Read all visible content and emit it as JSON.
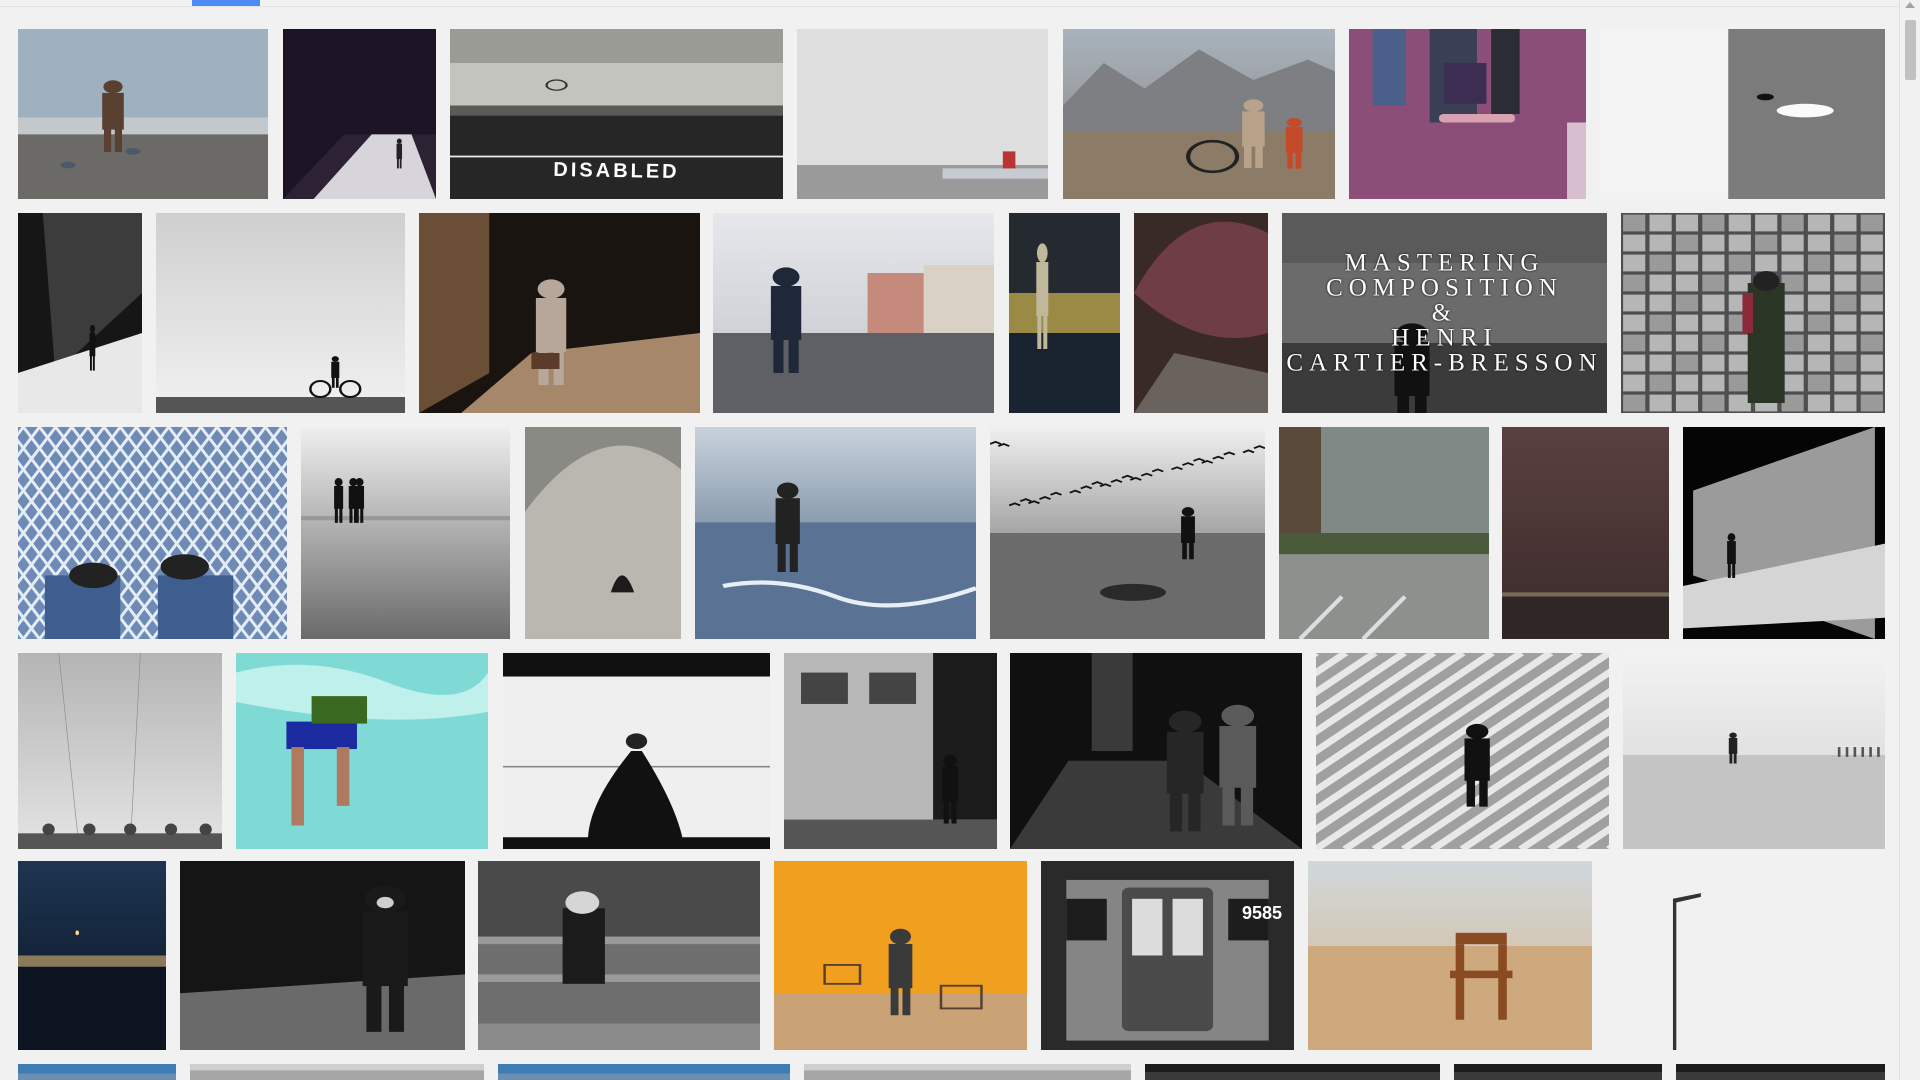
{
  "page": {
    "active_tab_color": "#4c8bf5",
    "rows": [
      {
        "images": [
          {
            "kind": "man-on-bench",
            "name": "image-man-bench-pigeons"
          },
          {
            "kind": "tunnel",
            "name": "image-dark-tunnel"
          },
          {
            "kind": "disabled-road",
            "name": "image-disabled-road",
            "text": "DISABLED"
          },
          {
            "kind": "white-wall-hydrant",
            "name": "image-white-wall-hydrant"
          },
          {
            "kind": "mountain-hoop",
            "name": "image-mountain-hoop-boys"
          },
          {
            "kind": "skateboard",
            "name": "image-purple-skateboard"
          },
          {
            "kind": "water-split",
            "name": "image-swans-water-split"
          }
        ]
      },
      {
        "images": [
          {
            "kind": "stairs-shadow",
            "name": "image-stairs-shadow"
          },
          {
            "kind": "bicycle",
            "name": "image-cyclist-horizon"
          },
          {
            "kind": "man-suitcase",
            "name": "image-man-suitcase"
          },
          {
            "kind": "city-walker",
            "name": "image-city-walker"
          },
          {
            "kind": "narrow-walker",
            "name": "image-narrow-walker"
          },
          {
            "kind": "umbrella",
            "name": "image-red-umbrella"
          },
          {
            "kind": "title-card",
            "name": "image-mastering-composition",
            "text": "MASTERING\nCOMPOSITION\n&\nHENRI\nCARTIER-BRESSON"
          },
          {
            "kind": "glass-grid",
            "name": "image-glass-block-wall"
          }
        ]
      },
      {
        "images": [
          {
            "kind": "mesh-feet",
            "name": "image-mesh-feet"
          },
          {
            "kind": "reflection",
            "name": "image-people-reflection"
          },
          {
            "kind": "cave-arch",
            "name": "image-cave-arch"
          },
          {
            "kind": "sea-chair",
            "name": "image-sea-chair"
          },
          {
            "kind": "birds-beach",
            "name": "image-birds-beach"
          },
          {
            "kind": "rainy-window",
            "name": "image-rainy-window"
          },
          {
            "kind": "dusk-field",
            "name": "image-dusk-field"
          },
          {
            "kind": "light-beam",
            "name": "image-light-beam"
          }
        ]
      },
      {
        "images": [
          {
            "kind": "power-lines",
            "name": "image-power-lines-trees"
          },
          {
            "kind": "swimmer",
            "name": "image-swimmer-pool"
          },
          {
            "kind": "cloaked-figure",
            "name": "image-cloaked-figure"
          },
          {
            "kind": "brick-building",
            "name": "image-brick-building-walker"
          },
          {
            "kind": "night-street",
            "name": "image-night-street"
          },
          {
            "kind": "diagonal-stripes",
            "name": "image-diagonal-stripes-walker"
          },
          {
            "kind": "foggy-beach",
            "name": "image-foggy-beach"
          }
        ]
      },
      {
        "images": [
          {
            "kind": "night-field",
            "name": "image-night-field"
          },
          {
            "kind": "old-man",
            "name": "image-old-man-walking"
          },
          {
            "kind": "girl-fence",
            "name": "image-girl-fence"
          },
          {
            "kind": "orange-wall",
            "name": "image-orange-wall-carts"
          },
          {
            "kind": "subway",
            "name": "image-subway-car",
            "text": "9585"
          },
          {
            "kind": "chair-beach",
            "name": "image-chair-beach"
          },
          {
            "kind": "lamp-post",
            "name": "image-lamp-post"
          }
        ]
      },
      {
        "images": [
          {
            "kind": "sky-partial",
            "name": "image-partial-1"
          },
          {
            "kind": "grey-partial",
            "name": "image-partial-2"
          },
          {
            "kind": "sky-partial",
            "name": "image-partial-3"
          },
          {
            "kind": "grey-partial",
            "name": "image-partial-4"
          },
          {
            "kind": "dark-partial",
            "name": "image-partial-5"
          },
          {
            "kind": "dark-partial",
            "name": "image-partial-6"
          },
          {
            "kind": "dark-partial",
            "name": "image-partial-7"
          }
        ]
      }
    ]
  }
}
